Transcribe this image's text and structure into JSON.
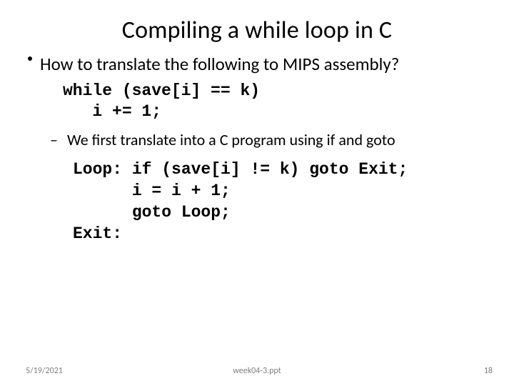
{
  "title": "Compiling a while loop in C",
  "bullet1": "How to translate the following to MIPS assembly?",
  "code1": "while (save[i] == k)\n   i += 1;",
  "bullet2": "We first translate into a C program using if and goto",
  "code2": "Loop: if (save[i] != k) goto Exit;\n      i = i + 1;\n      goto Loop;\nExit:",
  "footer": {
    "date": "5/19/2021",
    "file": "week04-3.ppt",
    "page": "18"
  }
}
